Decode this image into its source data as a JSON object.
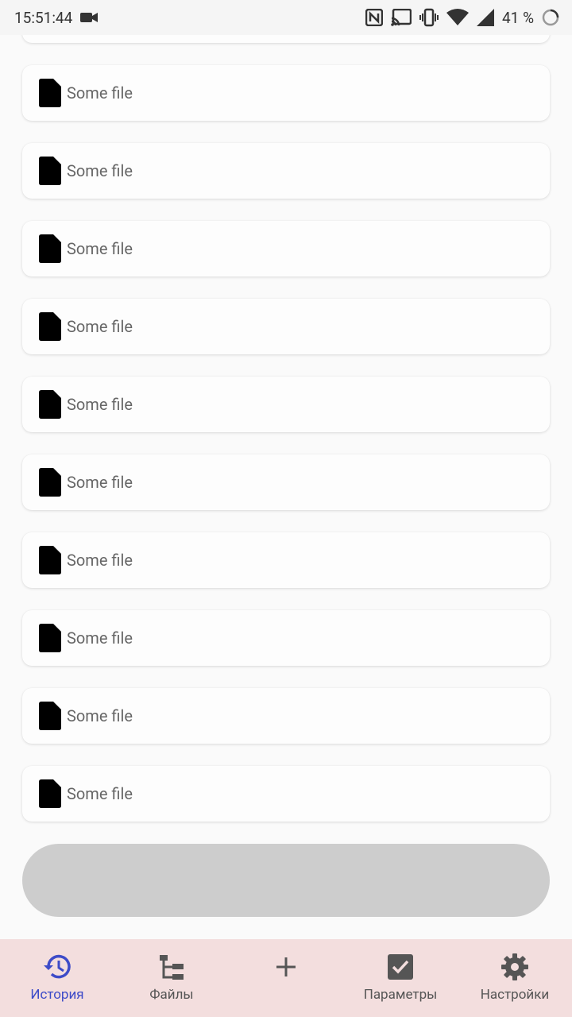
{
  "status_bar": {
    "time": "15:51:44",
    "battery": "41 %"
  },
  "files": [
    {
      "label": "Some file"
    },
    {
      "label": "Some file"
    },
    {
      "label": "Some file"
    },
    {
      "label": "Some file"
    },
    {
      "label": "Some file"
    },
    {
      "label": "Some file"
    },
    {
      "label": "Some file"
    },
    {
      "label": "Some file"
    },
    {
      "label": "Some file"
    },
    {
      "label": "Some file"
    }
  ],
  "bottom_nav": {
    "items": [
      {
        "label": "История",
        "icon": "history-icon",
        "active": true
      },
      {
        "label": "Файлы",
        "icon": "file-tree-icon",
        "active": false
      },
      {
        "label": "",
        "icon": "plus-icon",
        "active": false
      },
      {
        "label": "Параметры",
        "icon": "checkbox-icon",
        "active": false
      },
      {
        "label": "Настройки",
        "icon": "gear-icon",
        "active": false
      }
    ]
  },
  "colors": {
    "accent": "#3d4bc8",
    "nav_background": "#f3dede",
    "button_background": "#cdcdcd"
  }
}
